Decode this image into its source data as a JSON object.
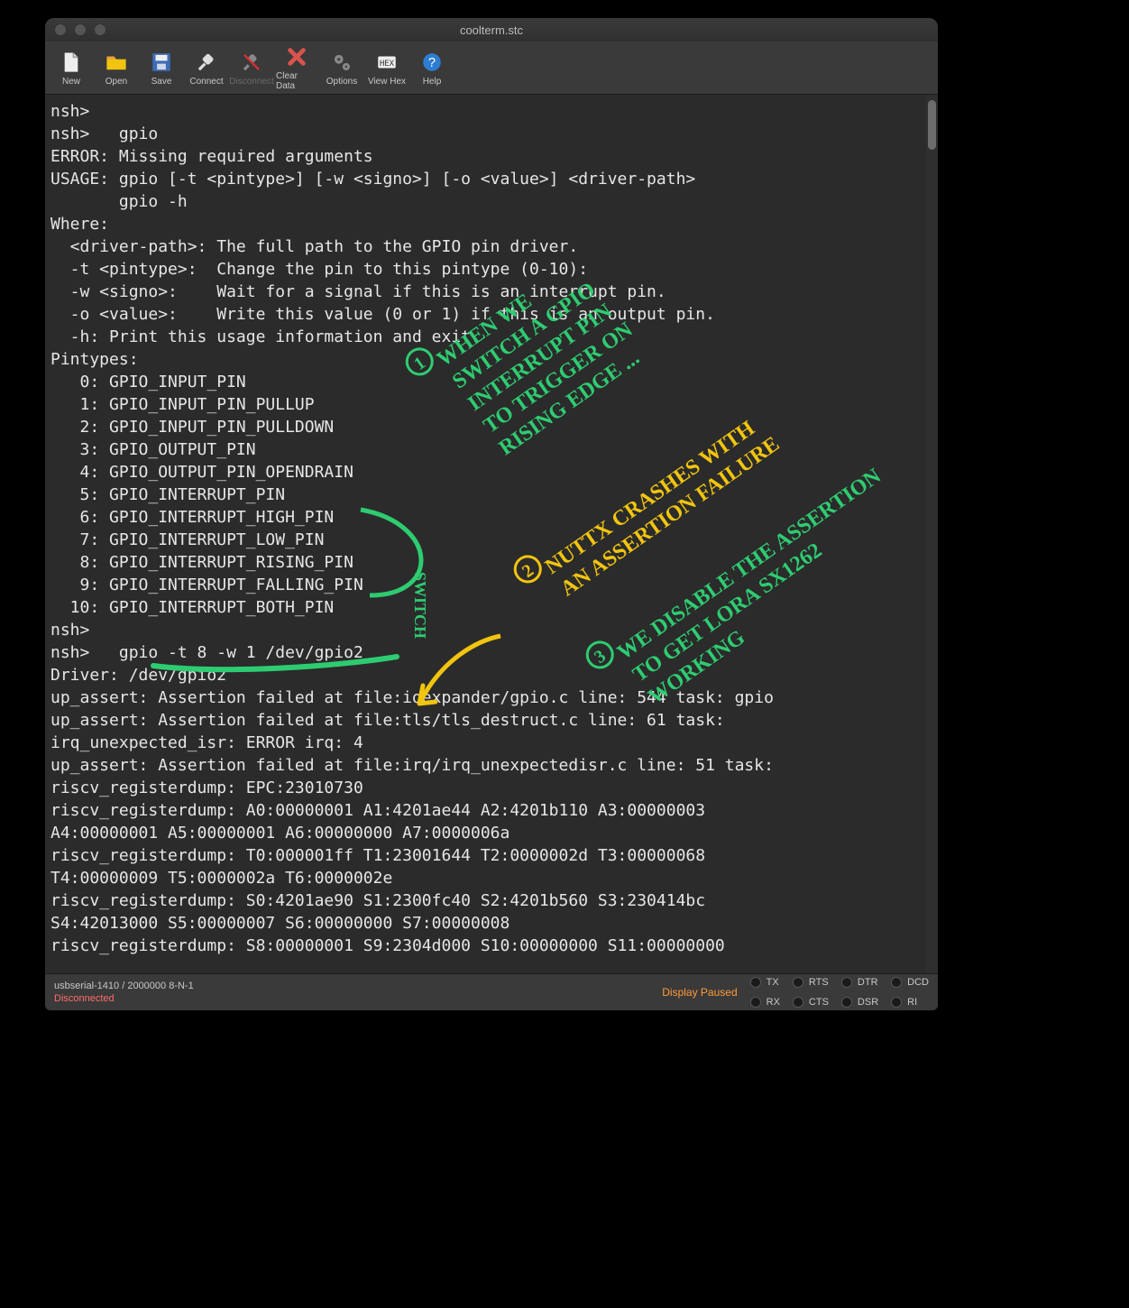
{
  "window": {
    "title": "coolterm.stc"
  },
  "toolbar": {
    "items": [
      {
        "name": "new",
        "label": "New",
        "icon": "file-icon",
        "disabled": false
      },
      {
        "name": "open",
        "label": "Open",
        "icon": "folder-icon",
        "disabled": false
      },
      {
        "name": "save",
        "label": "Save",
        "icon": "save-icon",
        "disabled": false
      },
      {
        "name": "connect",
        "label": "Connect",
        "icon": "plug-icon",
        "disabled": false
      },
      {
        "name": "disconnect",
        "label": "Disconnect",
        "icon": "unplug-icon",
        "disabled": true
      },
      {
        "name": "clear-data",
        "label": "Clear Data",
        "icon": "clear-icon",
        "disabled": false
      },
      {
        "name": "options",
        "label": "Options",
        "icon": "gears-icon",
        "disabled": false
      },
      {
        "name": "view-hex",
        "label": "View Hex",
        "icon": "hex-icon",
        "disabled": false
      },
      {
        "name": "help",
        "label": "Help",
        "icon": "help-icon",
        "disabled": false
      }
    ]
  },
  "terminal": {
    "lines": [
      "nsh>",
      "nsh>   gpio",
      "ERROR: Missing required arguments",
      "USAGE: gpio [-t <pintype>] [-w <signo>] [-o <value>] <driver-path>",
      "       gpio -h",
      "Where:",
      "  <driver-path>: The full path to the GPIO pin driver.",
      "  -t <pintype>:  Change the pin to this pintype (0-10):",
      "  -w <signo>:    Wait for a signal if this is an interrupt pin.",
      "  -o <value>:    Write this value (0 or 1) if this is an output pin.",
      "  -h: Print this usage information and exit.",
      "Pintypes:",
      "   0: GPIO_INPUT_PIN",
      "   1: GPIO_INPUT_PIN_PULLUP",
      "   2: GPIO_INPUT_PIN_PULLDOWN",
      "   3: GPIO_OUTPUT_PIN",
      "   4: GPIO_OUTPUT_PIN_OPENDRAIN",
      "   5: GPIO_INTERRUPT_PIN",
      "   6: GPIO_INTERRUPT_HIGH_PIN",
      "   7: GPIO_INTERRUPT_LOW_PIN",
      "   8: GPIO_INTERRUPT_RISING_PIN",
      "   9: GPIO_INTERRUPT_FALLING_PIN",
      "  10: GPIO_INTERRUPT_BOTH_PIN",
      "nsh>",
      "nsh>   gpio -t 8 -w 1 /dev/gpio2",
      "Driver: /dev/gpio2",
      "up_assert: Assertion failed at file:ioexpander/gpio.c line: 544 task: gpio",
      "up_assert: Assertion failed at file:tls/tls_destruct.c line: 61 task:",
      "irq_unexpected_isr: ERROR irq: 4",
      "up_assert: Assertion failed at file:irq/irq_unexpectedisr.c line: 51 task:",
      "riscv_registerdump: EPC:23010730",
      "riscv_registerdump: A0:00000001 A1:4201ae44 A2:4201b110 A3:00000003",
      "A4:00000001 A5:00000001 A6:00000000 A7:0000006a",
      "riscv_registerdump: T0:000001ff T1:23001644 T2:0000002d T3:00000068",
      "T4:00000009 T5:0000002a T6:0000002e",
      "riscv_registerdump: S0:4201ae90 S1:2300fc40 S2:4201b560 S3:230414bc",
      "S4:42013000 S5:00000007 S6:00000000 S7:00000008",
      "riscv_registerdump: S8:00000001 S9:2304d000 S10:00000000 S11:00000000"
    ]
  },
  "status": {
    "port": "usbserial-1410 / 2000000 8-N-1",
    "connection": "Disconnected",
    "display_paused": "Display Paused",
    "leds": [
      "TX",
      "RX",
      "RTS",
      "CTS",
      "DTR",
      "DSR",
      "DCD",
      "RI"
    ]
  },
  "annotations": {
    "note1": "① WHEN WE SWITCH A GPIO INTERRUPT PIN TO TRIGGER ON RISING EDGE ...",
    "note2": "② NUTTX CRASHES WITH AN ASSERTION FAILURE",
    "note3": "③ WE DISABLE THE ASSERTION TO GET LORA SX1262 WORKING",
    "switch_label": "SWITCH"
  }
}
